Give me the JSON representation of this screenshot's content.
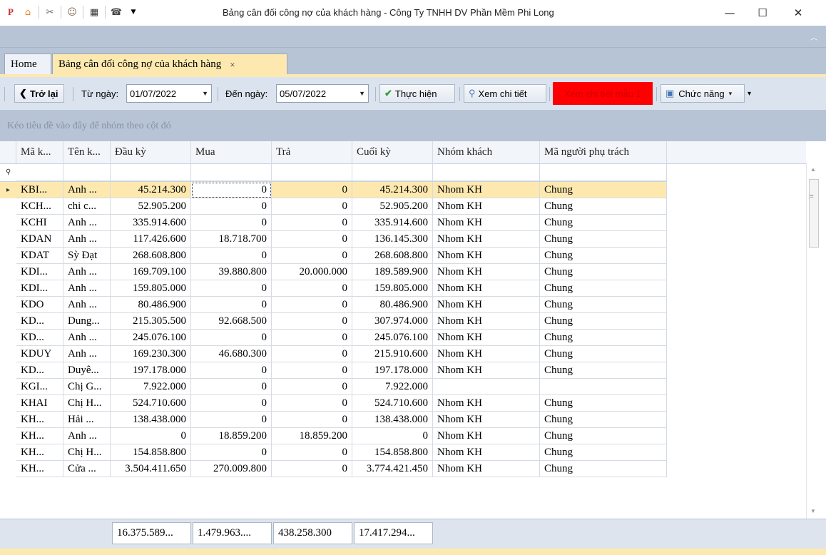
{
  "window": {
    "title": "Bảng cân đối công nợ của khách hàng - Công Ty TNHH DV Phần Mềm Phi Long",
    "minimize": "—",
    "maximize": "☐",
    "close": "✕"
  },
  "quick_access": [
    "app-logo-icon",
    "home-icon",
    "tools-icon",
    "users-icon",
    "clapperboard-icon",
    "phone-icon",
    "dropdown-icon"
  ],
  "tabs": [
    {
      "label": "Home"
    },
    {
      "label": "Bảng cân đối công nợ của khách hàng",
      "close": "×"
    }
  ],
  "toolbar": {
    "back_label": "Trở lại",
    "from_date_label": "Từ ngày:",
    "from_date_value": "01/07/2022",
    "to_date_label": "Đến ngày:",
    "to_date_value": "05/07/2022",
    "execute_label": "Thực hiện",
    "view_detail_label": "Xem chi tiết",
    "view_detail_template_label": "Xem chi tiết mẫu 1",
    "functions_label": "Chức năng"
  },
  "colors": {
    "accent_red": "#ff0000",
    "selected_row": "#fde9b0",
    "panel_blue": "#b7c4d6",
    "execute_green": "#2e9e3e"
  },
  "group_hint": "Kéo tiêu đề vào đây để nhóm theo cột đó",
  "columns": [
    "Mã k...",
    "Tên k...",
    "Đầu kỳ",
    "Mua",
    "Trả",
    "Cuối kỳ",
    "Nhóm khách",
    "Mã người phụ trách"
  ],
  "rows": [
    [
      "KBI...",
      "Anh ...",
      "45.214.300",
      "0",
      "0",
      "45.214.300",
      "Nhom KH",
      "Chung"
    ],
    [
      "KCH...",
      "chi c...",
      "52.905.200",
      "0",
      "0",
      "52.905.200",
      "Nhom KH",
      "Chung"
    ],
    [
      "KCHI",
      "Anh ...",
      "335.914.600",
      "0",
      "0",
      "335.914.600",
      "Nhom KH",
      "Chung"
    ],
    [
      "KDAN",
      "Anh ...",
      "117.426.600",
      "18.718.700",
      "0",
      "136.145.300",
      "Nhom KH",
      "Chung"
    ],
    [
      "KDAT",
      "Sỳ Đạt",
      "268.608.800",
      "0",
      "0",
      "268.608.800",
      "Nhom KH",
      "Chung"
    ],
    [
      "KDI...",
      "Anh ...",
      "169.709.100",
      "39.880.800",
      "20.000.000",
      "189.589.900",
      "Nhom KH",
      "Chung"
    ],
    [
      "KDI...",
      "Anh ...",
      "159.805.000",
      "0",
      "0",
      "159.805.000",
      "Nhom KH",
      "Chung"
    ],
    [
      "KDO",
      "Anh ...",
      "80.486.900",
      "0",
      "0",
      "80.486.900",
      "Nhom KH",
      "Chung"
    ],
    [
      "KD...",
      "Dung...",
      "215.305.500",
      "92.668.500",
      "0",
      "307.974.000",
      "Nhom KH",
      "Chung"
    ],
    [
      "KD...",
      "Anh ...",
      "245.076.100",
      "0",
      "0",
      "245.076.100",
      "Nhom KH",
      "Chung"
    ],
    [
      "KDUY",
      "Anh ...",
      "169.230.300",
      "46.680.300",
      "0",
      "215.910.600",
      "Nhom KH",
      "Chung"
    ],
    [
      "KD...",
      "Duyê...",
      "197.178.000",
      "0",
      "0",
      "197.178.000",
      "Nhom KH",
      "Chung"
    ],
    [
      "KGI...",
      "Chị G...",
      "7.922.000",
      "0",
      "0",
      "7.922.000",
      "",
      ""
    ],
    [
      "KHAI",
      "Chị H...",
      "524.710.600",
      "0",
      "0",
      "524.710.600",
      "Nhom KH",
      "Chung"
    ],
    [
      "KH...",
      "Hải ...",
      "138.438.000",
      "0",
      "0",
      "138.438.000",
      "Nhom KH",
      "Chung"
    ],
    [
      "KH...",
      "Anh ...",
      "0",
      "18.859.200",
      "18.859.200",
      "0",
      "Nhom KH",
      "Chung"
    ],
    [
      "KH...",
      "Chị H...",
      "154.858.800",
      "0",
      "0",
      "154.858.800",
      "Nhom KH",
      "Chung"
    ],
    [
      "KH...",
      "Cửa ...",
      "3.504.411.650",
      "270.009.800",
      "0",
      "3.774.421.450",
      "Nhom KH",
      "Chung"
    ]
  ],
  "totals": [
    "16.375.589...",
    "1.479.963....",
    "438.258.300",
    "17.417.294..."
  ]
}
